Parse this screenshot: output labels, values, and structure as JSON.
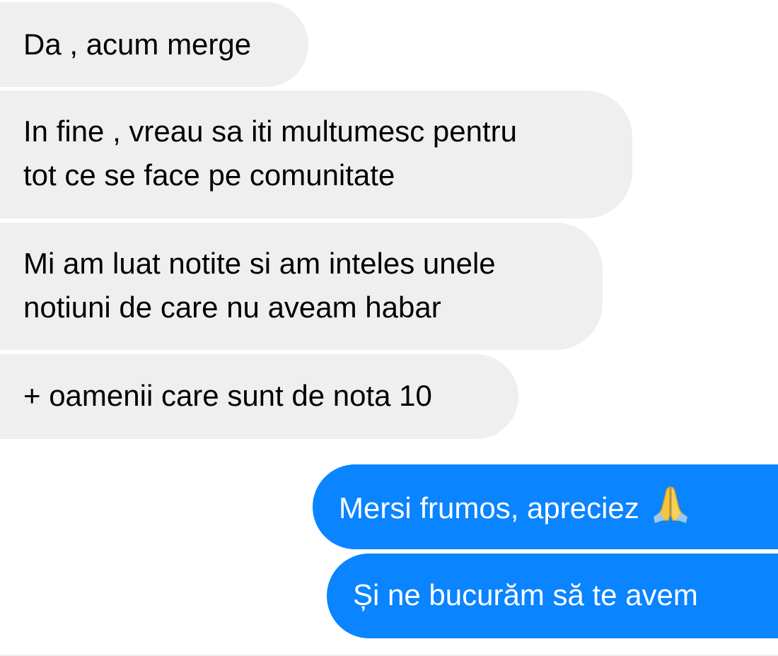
{
  "colors": {
    "incoming_bubble": "#efefef",
    "incoming_text": "#000000",
    "outgoing_bubble": "#0a84ff",
    "outgoing_text": "#ffffff"
  },
  "messages": [
    {
      "direction": "incoming",
      "lines": [
        "Da , acum merge"
      ]
    },
    {
      "direction": "incoming",
      "lines": [
        "In fine , vreau sa iti multumesc pentru",
        "tot ce se face pe comunitate"
      ]
    },
    {
      "direction": "incoming",
      "lines": [
        "Mi am luat notite si am inteles unele",
        "notiuni de care nu aveam habar"
      ]
    },
    {
      "direction": "incoming",
      "lines": [
        "+ oamenii care sunt de nota 10"
      ]
    },
    {
      "direction": "outgoing",
      "lines": [
        "Mersi frumos, apreciez"
      ],
      "emoji": "folded-hands-icon"
    },
    {
      "direction": "outgoing",
      "lines": [
        "Și ne bucurăm să te avem"
      ]
    }
  ]
}
